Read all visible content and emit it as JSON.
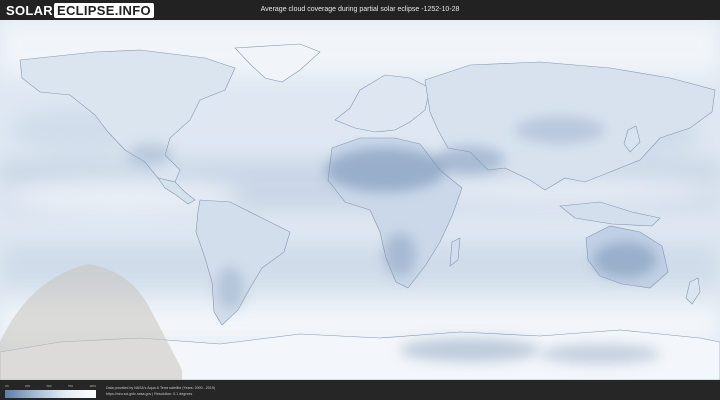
{
  "logo": {
    "part1": "SOLAR",
    "part2": "ECLIPSE.INFO"
  },
  "title": "Average cloud coverage during partial solar eclipse -1252-10-28",
  "legend": {
    "ticks": [
      "0%",
      "25%",
      "50%",
      "75%",
      "100%"
    ]
  },
  "credits": {
    "line1": "Data provided by NASA's Aqua & Terra satellite (Years: 2000 - 2019)",
    "line2": "https://neo.sci.gsfc.nasa.gov | Resolution: 0.1 degrees"
  },
  "colors": {
    "cloud_clear": "#5f7fa6",
    "cloud_full": "#ffffff",
    "land_outline": "#7f93ad",
    "eclipse_shadow": "#c9c4bd"
  }
}
